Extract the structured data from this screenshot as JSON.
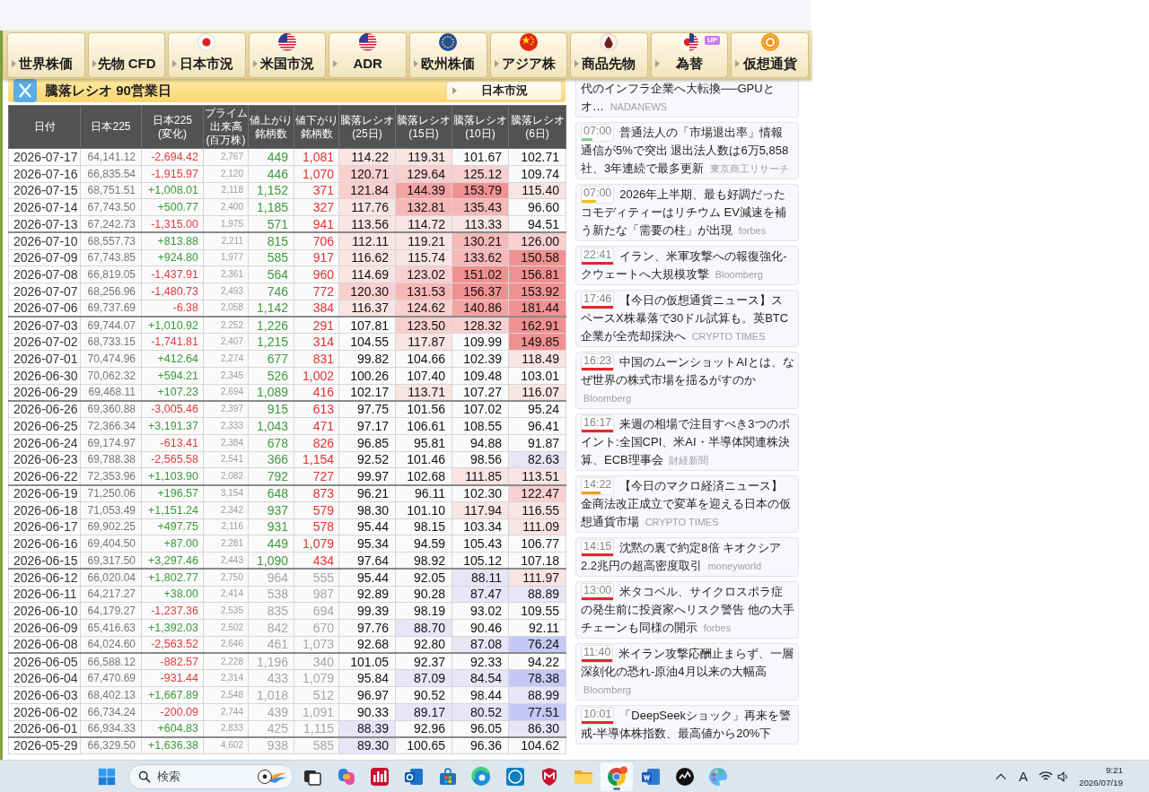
{
  "nav": [
    {
      "label": "世界株価"
    },
    {
      "label": "先物 CFD"
    },
    {
      "label": "日本市況"
    },
    {
      "label": "米国市況"
    },
    {
      "label": "ADR"
    },
    {
      "label": "欧州株価"
    },
    {
      "label": "アジア株"
    },
    {
      "label": "商品先物"
    },
    {
      "label": "為替",
      "badge": "UP"
    },
    {
      "label": "仮想通貨"
    }
  ],
  "panel": {
    "title": "騰落レシオ 90営業日",
    "link": "日本市況"
  },
  "table": {
    "columns": [
      "日付",
      "日本225",
      "日本225(変化)",
      "プライム出来高(百万株)",
      "値上がり銘柄数",
      "値下がり銘柄数",
      "騰落レシオ(25日)",
      "騰落レシオ(15日)",
      "騰落レシオ(10日)",
      "騰落レシオ(6日)"
    ],
    "rows": [
      {
        "date": "2026-07-17",
        "nikkei225": "64,141.12",
        "change": "-2,694.42",
        "rising": false,
        "volume": "2,767",
        "advancers": "449",
        "decliners": "1,081",
        "faded": false,
        "week_start": false,
        "ratios": [
          {
            "value": "114.22",
            "color": "#f9e4e4"
          },
          {
            "value": "119.31",
            "color": "#f9e4e4"
          },
          {
            "value": "101.67"
          },
          {
            "value": "102.71"
          }
        ]
      },
      {
        "date": "2026-07-16",
        "nikkei225": "66,835.54",
        "change": "-1,915.97",
        "rising": false,
        "volume": "2,120",
        "advancers": "446",
        "decliners": "1,070",
        "faded": false,
        "week_start": false,
        "ratios": [
          {
            "value": "120.71",
            "color": "#f9cfcf"
          },
          {
            "value": "129.64",
            "color": "#f9cfcf"
          },
          {
            "value": "125.12",
            "color": "#f9cfcf"
          },
          {
            "value": "109.74"
          }
        ]
      },
      {
        "date": "2026-07-15",
        "nikkei225": "68,751.51",
        "change": "+1,008.01",
        "rising": true,
        "volume": "2,118",
        "advancers": "1,152",
        "decliners": "371",
        "faded": false,
        "week_start": false,
        "ratios": [
          {
            "value": "121.84",
            "color": "#f9cfcf"
          },
          {
            "value": "144.39",
            "color": "#f4a3a3"
          },
          {
            "value": "153.79",
            "color": "#f19090"
          },
          {
            "value": "115.40",
            "color": "#f9e4e4"
          }
        ]
      },
      {
        "date": "2026-07-14",
        "nikkei225": "67,743.50",
        "change": "+500.77",
        "rising": true,
        "volume": "2,400",
        "advancers": "1,185",
        "decliners": "327",
        "faded": false,
        "week_start": false,
        "ratios": [
          {
            "value": "117.76",
            "color": "#f9e4e4"
          },
          {
            "value": "132.81",
            "color": "#f7b8b8"
          },
          {
            "value": "135.43",
            "color": "#f7b8b8"
          },
          {
            "value": "96.60"
          }
        ]
      },
      {
        "date": "2026-07-13",
        "nikkei225": "67,242.73",
        "change": "-1,315.00",
        "rising": false,
        "volume": "1,975",
        "advancers": "571",
        "decliners": "941",
        "faded": false,
        "week_start": false,
        "ratios": [
          {
            "value": "113.56",
            "color": "#f9e4e4"
          },
          {
            "value": "114.72",
            "color": "#f9e4e4"
          },
          {
            "value": "113.33",
            "color": "#f9e4e4"
          },
          {
            "value": "94.51"
          }
        ]
      },
      {
        "date": "2026-07-10",
        "nikkei225": "68,557.73",
        "change": "+813.88",
        "rising": true,
        "volume": "2,211",
        "advancers": "815",
        "decliners": "706",
        "faded": false,
        "week_start": true,
        "ratios": [
          {
            "value": "112.11",
            "color": "#f9e4e4"
          },
          {
            "value": "119.21",
            "color": "#f9e4e4"
          },
          {
            "value": "130.21",
            "color": "#f7b8b8"
          },
          {
            "value": "126.00",
            "color": "#f9cfcf"
          }
        ]
      },
      {
        "date": "2026-07-09",
        "nikkei225": "67,743.85",
        "change": "+924.80",
        "rising": true,
        "volume": "1,977",
        "advancers": "585",
        "decliners": "917",
        "faded": false,
        "week_start": false,
        "ratios": [
          {
            "value": "116.62",
            "color": "#f9e4e4"
          },
          {
            "value": "115.74",
            "color": "#f9e4e4"
          },
          {
            "value": "133.62",
            "color": "#f7b8b8"
          },
          {
            "value": "150.58",
            "color": "#f19090"
          }
        ]
      },
      {
        "date": "2026-07-08",
        "nikkei225": "66,819.05",
        "change": "-1,437.91",
        "rising": false,
        "volume": "2,361",
        "advancers": "564",
        "decliners": "960",
        "faded": false,
        "week_start": false,
        "ratios": [
          {
            "value": "114.69",
            "color": "#f9e4e4"
          },
          {
            "value": "123.02",
            "color": "#f9cfcf"
          },
          {
            "value": "151.02",
            "color": "#f19090"
          },
          {
            "value": "156.81",
            "color": "#f19090"
          }
        ]
      },
      {
        "date": "2026-07-07",
        "nikkei225": "68,256.96",
        "change": "-1,480.73",
        "rising": false,
        "volume": "2,493",
        "advancers": "746",
        "decliners": "772",
        "faded": false,
        "week_start": false,
        "ratios": [
          {
            "value": "120.30",
            "color": "#f9cfcf"
          },
          {
            "value": "131.53",
            "color": "#f7b8b8"
          },
          {
            "value": "156.37",
            "color": "#f19090"
          },
          {
            "value": "153.92",
            "color": "#f19090"
          }
        ]
      },
      {
        "date": "2026-07-06",
        "nikkei225": "69,737.69",
        "change": "-6.38",
        "rising": false,
        "volume": "2,058",
        "advancers": "1,142",
        "decliners": "384",
        "faded": false,
        "week_start": false,
        "ratios": [
          {
            "value": "116.37",
            "color": "#f9e4e4"
          },
          {
            "value": "124.62",
            "color": "#f9cfcf"
          },
          {
            "value": "140.86",
            "color": "#f4a3a3"
          },
          {
            "value": "181.44",
            "color": "#f19090"
          }
        ]
      },
      {
        "date": "2026-07-03",
        "nikkei225": "69,744.07",
        "change": "+1,010.92",
        "rising": true,
        "volume": "2,252",
        "advancers": "1,226",
        "decliners": "291",
        "faded": false,
        "week_start": true,
        "ratios": [
          {
            "value": "107.81"
          },
          {
            "value": "123.50",
            "color": "#f9cfcf"
          },
          {
            "value": "128.32",
            "color": "#f9cfcf"
          },
          {
            "value": "162.91",
            "color": "#f19090"
          }
        ]
      },
      {
        "date": "2026-07-02",
        "nikkei225": "68,733.15",
        "change": "-1,741.81",
        "rising": false,
        "volume": "2,407",
        "advancers": "1,215",
        "decliners": "314",
        "faded": false,
        "week_start": false,
        "ratios": [
          {
            "value": "104.55"
          },
          {
            "value": "117.87",
            "color": "#f9e4e4"
          },
          {
            "value": "109.99"
          },
          {
            "value": "149.85",
            "color": "#f19090"
          }
        ]
      },
      {
        "date": "2026-07-01",
        "nikkei225": "70,474.96",
        "change": "+412.64",
        "rising": true,
        "volume": "2,274",
        "advancers": "677",
        "decliners": "831",
        "faded": false,
        "week_start": false,
        "ratios": [
          {
            "value": "99.82"
          },
          {
            "value": "104.66"
          },
          {
            "value": "102.39"
          },
          {
            "value": "118.49",
            "color": "#f9e4e4"
          }
        ]
      },
      {
        "date": "2026-06-30",
        "nikkei225": "70,062.32",
        "change": "+594.21",
        "rising": true,
        "volume": "2,345",
        "advancers": "526",
        "decliners": "1,002",
        "faded": false,
        "week_start": false,
        "ratios": [
          {
            "value": "100.26"
          },
          {
            "value": "107.40"
          },
          {
            "value": "109.48"
          },
          {
            "value": "103.01"
          }
        ]
      },
      {
        "date": "2026-06-29",
        "nikkei225": "69,468.11",
        "change": "+107.23",
        "rising": true,
        "volume": "2,694",
        "advancers": "1,089",
        "decliners": "416",
        "faded": false,
        "week_start": false,
        "ratios": [
          {
            "value": "102.17"
          },
          {
            "value": "113.71",
            "color": "#f9e4e4"
          },
          {
            "value": "107.27"
          },
          {
            "value": "116.07",
            "color": "#f9e4e4"
          }
        ]
      },
      {
        "date": "2026-06-26",
        "nikkei225": "69,360.88",
        "change": "-3,005.46",
        "rising": false,
        "volume": "2,397",
        "advancers": "915",
        "decliners": "613",
        "faded": false,
        "week_start": true,
        "ratios": [
          {
            "value": "97.75"
          },
          {
            "value": "101.56"
          },
          {
            "value": "107.02"
          },
          {
            "value": "95.24"
          }
        ]
      },
      {
        "date": "2026-06-25",
        "nikkei225": "72,366.34",
        "change": "+3,191.37",
        "rising": true,
        "volume": "2,333",
        "advancers": "1,043",
        "decliners": "471",
        "faded": false,
        "week_start": false,
        "ratios": [
          {
            "value": "97.17"
          },
          {
            "value": "106.61"
          },
          {
            "value": "108.55"
          },
          {
            "value": "96.41"
          }
        ]
      },
      {
        "date": "2026-06-24",
        "nikkei225": "69,174.97",
        "change": "-613.41",
        "rising": false,
        "volume": "2,384",
        "advancers": "678",
        "decliners": "826",
        "faded": false,
        "week_start": false,
        "ratios": [
          {
            "value": "96.85"
          },
          {
            "value": "95.81"
          },
          {
            "value": "94.88"
          },
          {
            "value": "91.87"
          }
        ]
      },
      {
        "date": "2026-06-23",
        "nikkei225": "69,788.38",
        "change": "-2,565.58",
        "rising": false,
        "volume": "2,541",
        "advancers": "366",
        "decliners": "1,154",
        "faded": false,
        "week_start": false,
        "ratios": [
          {
            "value": "92.52"
          },
          {
            "value": "101.46"
          },
          {
            "value": "98.56"
          },
          {
            "value": "82.63",
            "color": "#e6e6f8"
          }
        ]
      },
      {
        "date": "2026-06-22",
        "nikkei225": "72,353.96",
        "change": "+1,103.90",
        "rising": true,
        "volume": "2,082",
        "advancers": "792",
        "decliners": "727",
        "faded": false,
        "week_start": false,
        "ratios": [
          {
            "value": "99.97"
          },
          {
            "value": "102.68"
          },
          {
            "value": "111.85",
            "color": "#f9e4e4"
          },
          {
            "value": "113.51",
            "color": "#f9e4e4"
          }
        ]
      },
      {
        "date": "2026-06-19",
        "nikkei225": "71,250.06",
        "change": "+196.57",
        "rising": true,
        "volume": "3,154",
        "advancers": "648",
        "decliners": "873",
        "faded": false,
        "week_start": true,
        "ratios": [
          {
            "value": "96.21"
          },
          {
            "value": "96.11"
          },
          {
            "value": "102.30"
          },
          {
            "value": "122.47",
            "color": "#f9cfcf"
          }
        ]
      },
      {
        "date": "2026-06-18",
        "nikkei225": "71,053.49",
        "change": "+1,151.24",
        "rising": true,
        "volume": "2,342",
        "advancers": "937",
        "decliners": "579",
        "faded": false,
        "week_start": false,
        "ratios": [
          {
            "value": "98.30"
          },
          {
            "value": "101.10"
          },
          {
            "value": "117.94",
            "color": "#f9e4e4"
          },
          {
            "value": "116.55",
            "color": "#f9e4e4"
          }
        ]
      },
      {
        "date": "2026-06-17",
        "nikkei225": "69,902.25",
        "change": "+497.75",
        "rising": true,
        "volume": "2,116",
        "advancers": "931",
        "decliners": "578",
        "faded": false,
        "week_start": false,
        "ratios": [
          {
            "value": "95.44"
          },
          {
            "value": "98.15"
          },
          {
            "value": "103.34"
          },
          {
            "value": "111.09",
            "color": "#f9e4e4"
          }
        ]
      },
      {
        "date": "2026-06-16",
        "nikkei225": "69,404.50",
        "change": "+87.00",
        "rising": true,
        "volume": "2,281",
        "advancers": "449",
        "decliners": "1,079",
        "faded": false,
        "week_start": false,
        "ratios": [
          {
            "value": "95.34"
          },
          {
            "value": "94.59"
          },
          {
            "value": "105.43"
          },
          {
            "value": "106.77"
          }
        ]
      },
      {
        "date": "2026-06-15",
        "nikkei225": "69,317.50",
        "change": "+3,297.46",
        "rising": true,
        "volume": "2,443",
        "advancers": "1,090",
        "decliners": "434",
        "faded": false,
        "week_start": false,
        "ratios": [
          {
            "value": "97.64"
          },
          {
            "value": "98.92"
          },
          {
            "value": "105.12"
          },
          {
            "value": "107.18"
          }
        ]
      },
      {
        "date": "2026-06-12",
        "nikkei225": "66,020.04",
        "change": "+1,802.77",
        "rising": true,
        "volume": "2,750",
        "advancers": "964",
        "decliners": "555",
        "faded": true,
        "week_start": true,
        "ratios": [
          {
            "value": "95.44"
          },
          {
            "value": "92.05"
          },
          {
            "value": "88.11",
            "color": "#e6e6f8"
          },
          {
            "value": "111.97",
            "color": "#f9e4e4"
          }
        ]
      },
      {
        "date": "2026-06-11",
        "nikkei225": "64,217.27",
        "change": "+38.00",
        "rising": true,
        "volume": "2,414",
        "advancers": "538",
        "decliners": "987",
        "faded": true,
        "week_start": false,
        "ratios": [
          {
            "value": "92.89"
          },
          {
            "value": "90.28"
          },
          {
            "value": "87.47",
            "color": "#e6e6f8"
          },
          {
            "value": "88.89",
            "color": "#e6e6f8"
          }
        ]
      },
      {
        "date": "2026-06-10",
        "nikkei225": "64,179.27",
        "change": "-1,237.36",
        "rising": false,
        "volume": "2,535",
        "advancers": "835",
        "decliners": "694",
        "faded": true,
        "week_start": false,
        "ratios": [
          {
            "value": "99.39"
          },
          {
            "value": "98.19"
          },
          {
            "value": "93.02"
          },
          {
            "value": "109.55"
          }
        ]
      },
      {
        "date": "2026-06-09",
        "nikkei225": "65,416.63",
        "change": "+1,392.03",
        "rising": true,
        "volume": "2,502",
        "advancers": "842",
        "decliners": "670",
        "faded": true,
        "week_start": false,
        "ratios": [
          {
            "value": "97.76"
          },
          {
            "value": "88.70",
            "color": "#e6e6f8"
          },
          {
            "value": "90.46"
          },
          {
            "value": "92.11"
          }
        ]
      },
      {
        "date": "2026-06-08",
        "nikkei225": "64,024.60",
        "change": "-2,563.52",
        "rising": false,
        "volume": "2,646",
        "advancers": "461",
        "decliners": "1,073",
        "faded": true,
        "week_start": false,
        "ratios": [
          {
            "value": "92.68"
          },
          {
            "value": "92.80"
          },
          {
            "value": "87.08",
            "color": "#e6e6f8"
          },
          {
            "value": "76.24",
            "color": "#c7c7f8"
          }
        ]
      },
      {
        "date": "2026-06-05",
        "nikkei225": "66,588.12",
        "change": "-882.57",
        "rising": false,
        "volume": "2,228",
        "advancers": "1,196",
        "decliners": "340",
        "faded": true,
        "week_start": true,
        "ratios": [
          {
            "value": "101.05"
          },
          {
            "value": "92.37"
          },
          {
            "value": "92.33"
          },
          {
            "value": "94.22"
          }
        ]
      },
      {
        "date": "2026-06-04",
        "nikkei225": "67,470.69",
        "change": "-931.44",
        "rising": false,
        "volume": "2,314",
        "advancers": "433",
        "decliners": "1,079",
        "faded": true,
        "week_start": false,
        "ratios": [
          {
            "value": "95.84"
          },
          {
            "value": "87.09",
            "color": "#e6e6f8"
          },
          {
            "value": "84.54",
            "color": "#e6e6f8"
          },
          {
            "value": "78.38",
            "color": "#c7c7f8"
          }
        ]
      },
      {
        "date": "2026-06-03",
        "nikkei225": "68,402.13",
        "change": "+1,667.89",
        "rising": true,
        "volume": "2,548",
        "advancers": "1,018",
        "decliners": "512",
        "faded": true,
        "week_start": false,
        "ratios": [
          {
            "value": "96.97"
          },
          {
            "value": "90.52"
          },
          {
            "value": "98.44"
          },
          {
            "value": "88.99",
            "color": "#e6e6f8"
          }
        ]
      },
      {
        "date": "2026-06-02",
        "nikkei225": "66,734.24",
        "change": "-200.09",
        "rising": false,
        "volume": "2,744",
        "advancers": "439",
        "decliners": "1,091",
        "faded": true,
        "week_start": false,
        "ratios": [
          {
            "value": "90.33"
          },
          {
            "value": "89.17",
            "color": "#e6e6f8"
          },
          {
            "value": "80.52",
            "color": "#e6e6f8"
          },
          {
            "value": "77.51",
            "color": "#c7c7f8"
          }
        ]
      },
      {
        "date": "2026-06-01",
        "nikkei225": "66,934.33",
        "change": "+604.83",
        "rising": true,
        "volume": "2,833",
        "advancers": "425",
        "decliners": "1,115",
        "faded": true,
        "week_start": false,
        "ratios": [
          {
            "value": "88.39",
            "color": "#e6e6f8"
          },
          {
            "value": "92.96"
          },
          {
            "value": "96.05"
          },
          {
            "value": "86.30",
            "color": "#e6e6f8"
          }
        ]
      },
      {
        "date": "2026-05-29",
        "nikkei225": "66,329.50",
        "change": "+1,636.38",
        "rising": true,
        "volume": "4,602",
        "advancers": "938",
        "decliners": "585",
        "faded": true,
        "week_start": true,
        "ratios": [
          {
            "value": "89.30",
            "color": "#e6e6f8"
          },
          {
            "value": "100.65"
          },
          {
            "value": "96.36"
          },
          {
            "value": "104.62"
          }
        ]
      }
    ]
  },
  "news": [
    {
      "headline": "代のインフラ企業へ大転換──GPUとオ…",
      "source": "NADANEWS"
    },
    {
      "time": "07:00",
      "color": "#7ed68c",
      "level": 0.35,
      "headline": "普通法人の「市場退出率」情報通信が5%で突出 退出法人数は6万5,858社、3年連続で最多更新",
      "source": "東京商工リサーチ"
    },
    {
      "time": "07:00",
      "color": "#f4c20d",
      "level": 0.45,
      "headline": "2026年上半期、最も好調だったコモディティーはリチウム EV減速を補う新たな「需要の柱」が出現",
      "source": "forbes"
    },
    {
      "time": "22:41",
      "color": "#e8262a",
      "level": 1,
      "headline": "イラン、米軍攻撃への報復強化-クウェートへ大規模攻撃",
      "source": "Bloomberg"
    },
    {
      "time": "17:46",
      "color": "#e8262a",
      "level": 1,
      "headline": "【今日の仮想通貨ニュース】スペースX株暴落で30ドル試算も。英BTC企業が全売却採決へ",
      "source": "CRYPTO TIMES"
    },
    {
      "time": "16:23",
      "color": "#e8262a",
      "level": 1,
      "headline": "中国のムーンショットAIとは、なぜ世界の株式市場を揺るがすのか",
      "source": "Bloomberg"
    },
    {
      "time": "16:17",
      "color": "#e8262a",
      "level": 1,
      "headline": "来週の相場で注目すべき3つのポイント:全国CPI、米AI・半導体関連株決算、ECB理事会",
      "source": "財経新聞"
    },
    {
      "time": "14:22",
      "color": "#f39a1e",
      "level": 0.6,
      "headline": "【今日のマクロ経済ニュース】金商法改正成立で変革を迎える日本の仮想通貨市場",
      "source": "CRYPTO TIMES"
    },
    {
      "time": "14:15",
      "color": "#e8262a",
      "level": 1,
      "headline": "沈黙の裏で約定8倍 キオクシア2.2兆円の超高密度取引",
      "source": "moneyworld"
    },
    {
      "time": "13:00",
      "color": "#e8262a",
      "level": 1,
      "headline": "米タコベル、サイクロスポラ症の発生前に投資家へリスク警告 他の大手チェーンも同様の開示",
      "source": "forbes"
    },
    {
      "time": "11:40",
      "color": "#e8262a",
      "level": 1,
      "headline": "米イラン攻撃応酬止まらず、一層深刻化の恐れ-原油4月以来の大幅高",
      "source": "Bloomberg"
    },
    {
      "time": "10:01",
      "color": "#e8262a",
      "level": 1,
      "headline": "「DeepSeekショック」再来を警戒-半導体株指数、最高値から20%下"
    }
  ],
  "taskbar": {
    "search": {
      "placeholder": "検索"
    },
    "apps": [
      {
        "selected": false
      },
      {
        "selected": false
      },
      {
        "selected": false
      },
      {
        "selected": false
      },
      {
        "selected": false
      },
      {
        "selected": false
      },
      {
        "selected": false
      },
      {
        "selected": false
      },
      {
        "selected": false
      },
      {
        "selected": true
      },
      {
        "selected": false
      },
      {
        "selected": false
      },
      {
        "selected": false
      }
    ],
    "ime": "A",
    "time": "9:21",
    "date": "2026/07/19"
  }
}
